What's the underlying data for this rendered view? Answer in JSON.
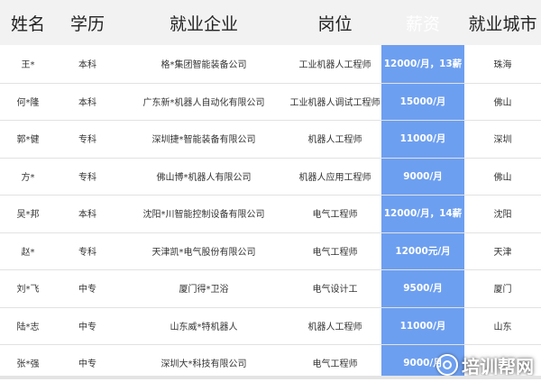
{
  "headers": [
    "姓名",
    "学历",
    "就业企业",
    "岗位",
    "薪资",
    "就业城市"
  ],
  "rows": [
    {
      "name": "王*",
      "edu": "本科",
      "company": "格*集团智能装备公司",
      "position": "工业机器人工程师",
      "salary": "12000/月，13薪",
      "city": "珠海"
    },
    {
      "name": "何*隆",
      "edu": "本科",
      "company": "广东新*机器人自动化有限公司",
      "position": "工业机器人调试工程师",
      "salary": "15000/月",
      "city": "佛山"
    },
    {
      "name": "郭*健",
      "edu": "专科",
      "company": "深圳捷*智能装备有限公司",
      "position": "机器人工程师",
      "salary": "11000/月",
      "city": "深圳"
    },
    {
      "name": "方*",
      "edu": "专科",
      "company": "佛山博*机器人有限公司",
      "position": "机器人应用工程师",
      "salary": "9000/月",
      "city": "佛山"
    },
    {
      "name": "吴*邦",
      "edu": "本科",
      "company": "沈阳*川智能控制设备有限公司",
      "position": "电气工程师",
      "salary": "12000/月，14薪",
      "city": "沈阳"
    },
    {
      "name": "赵*",
      "edu": "专科",
      "company": "天津凯*电气股份有限公司",
      "position": "电气工程师",
      "salary": "12000元/月",
      "city": "天津"
    },
    {
      "name": "刘*飞",
      "edu": "中专",
      "company": "厦门得*卫浴",
      "position": "电气设计工",
      "salary": "9500/月",
      "city": "厦门"
    },
    {
      "name": "陆*志",
      "edu": "中专",
      "company": "山东威*特机器人",
      "position": "机器人工程师",
      "salary": "11000/月",
      "city": "山东"
    },
    {
      "name": "张*强",
      "edu": "中专",
      "company": "深圳大*科技有限公司",
      "position": "电气工程师",
      "salary": "9000/月",
      "city": ""
    }
  ],
  "watermark": {
    "text": "培训帮网",
    "icon": "training-logo-icon"
  },
  "colors": {
    "salary_column": "#6d9ff0",
    "header_bg": "#f2f2f2"
  }
}
